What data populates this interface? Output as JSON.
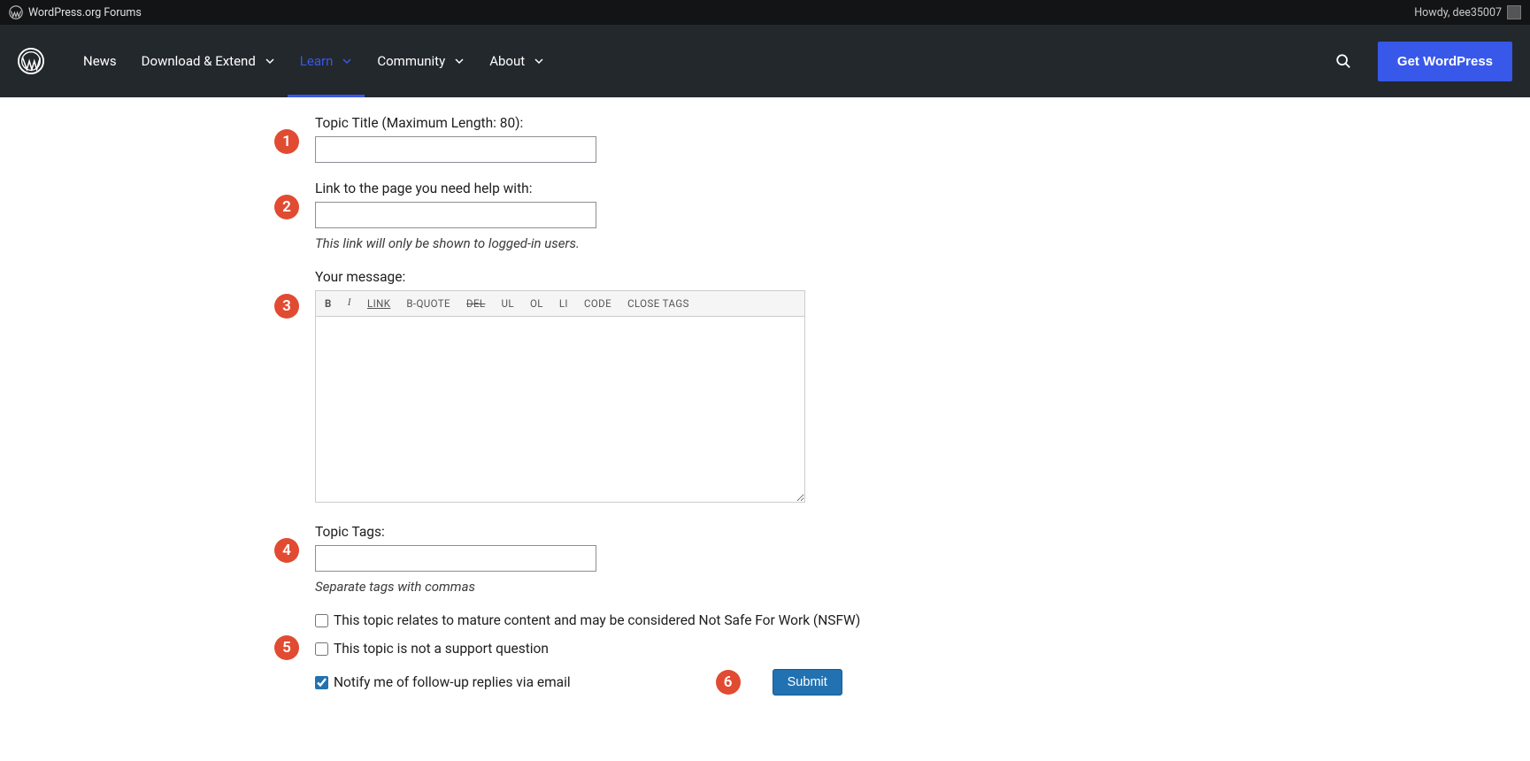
{
  "adminbar": {
    "site_title": "WordPress.org Forums",
    "howdy": "Howdy, dee35007"
  },
  "nav": {
    "items": [
      {
        "label": "News",
        "has_sub": false
      },
      {
        "label": "Download & Extend",
        "has_sub": true
      },
      {
        "label": "Learn",
        "has_sub": true,
        "active": true
      },
      {
        "label": "Community",
        "has_sub": true
      },
      {
        "label": "About",
        "has_sub": true
      }
    ],
    "get_wp": "Get WordPress"
  },
  "form": {
    "title_label": "Topic Title (Maximum Length: 80):",
    "link_label": "Link to the page you need help with:",
    "link_hint": "This link will only be shown to logged-in users.",
    "message_label": "Your message:",
    "toolbar": {
      "b": "B",
      "i": "I",
      "link": "LINK",
      "bquote": "B-QUOTE",
      "del": "DEL",
      "ul": "UL",
      "ol": "OL",
      "li": "LI",
      "code": "CODE",
      "close": "CLOSE TAGS"
    },
    "tags_label": "Topic Tags:",
    "tags_hint": "Separate tags with commas",
    "cb_nsfw": "This topic relates to mature content and may be considered Not Safe For Work (NSFW)",
    "cb_not_support": "This topic is not a support question",
    "cb_notify": "Notify me of follow-up replies via email",
    "submit": "Submit"
  },
  "annotations": {
    "1": "1",
    "2": "2",
    "3": "3",
    "4": "4",
    "5": "5",
    "6": "6"
  }
}
